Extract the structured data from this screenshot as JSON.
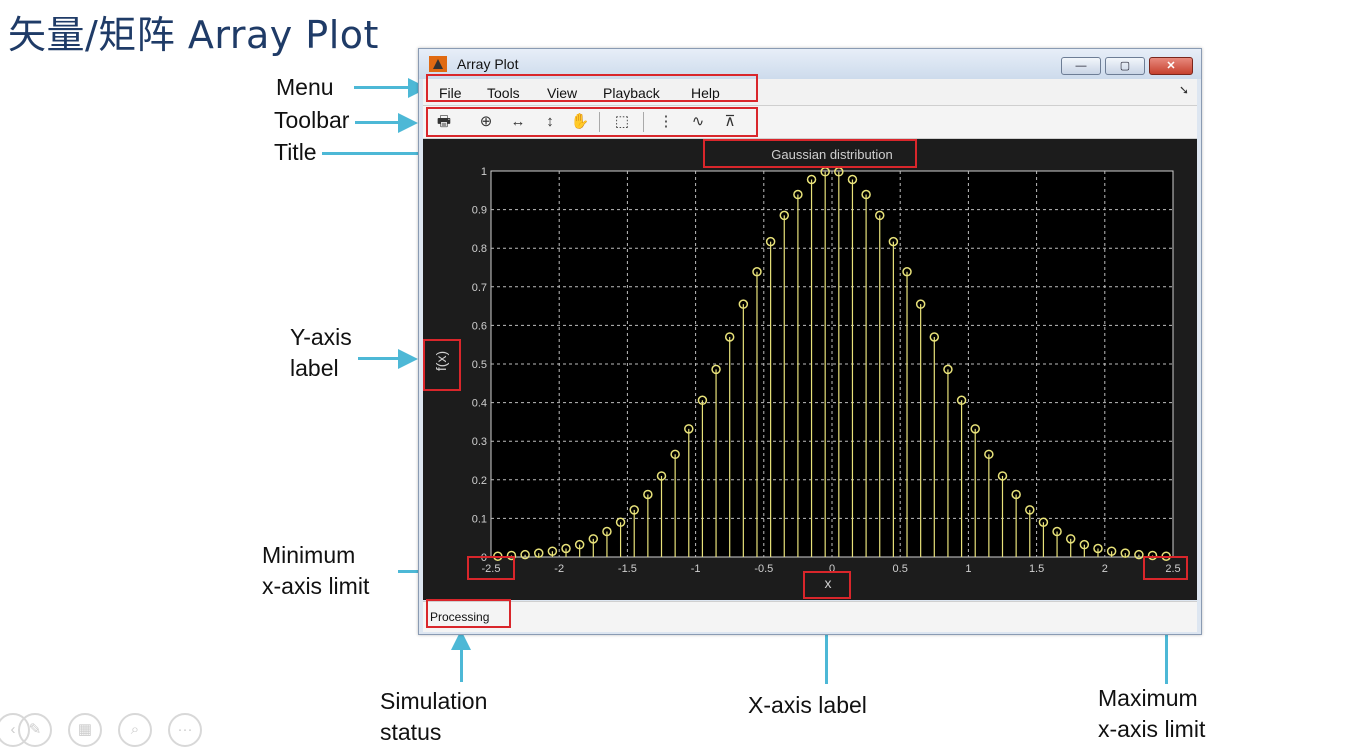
{
  "slide": {
    "title": "矢量/矩阵 Array Plot"
  },
  "callouts": {
    "menu": "Menu",
    "toolbar": "Toolbar",
    "title": "Title",
    "y_axis_label": [
      "Y-axis",
      "label"
    ],
    "min_x_limit": [
      "Minimum",
      "x-axis limit"
    ],
    "simulation_status": [
      "Simulation",
      "status"
    ],
    "x_axis_label": "X-axis label",
    "max_x_limit": [
      "Maximum",
      "x-axis limit"
    ]
  },
  "window": {
    "title": "Array Plot",
    "controls": {
      "minimize": "—",
      "maximize": "▢",
      "close": "✕"
    },
    "menu": [
      "File",
      "Tools",
      "View",
      "Playback",
      "Help"
    ],
    "menu_dock_icon": "dock-arrow-icon",
    "toolbar": [
      {
        "name": "print-icon",
        "glyph": "🖶"
      },
      {
        "name": "zoom-in-icon",
        "glyph": "⊕"
      },
      {
        "name": "zoom-x-icon",
        "glyph": "↔"
      },
      {
        "name": "zoom-y-icon",
        "glyph": "↕"
      },
      {
        "name": "pan-hand-icon",
        "glyph": "✋"
      },
      {
        "name": "autoscale-icon",
        "glyph": "⬚"
      },
      {
        "name": "cursor-measurements-icon",
        "glyph": "⋮"
      },
      {
        "name": "signal-statistics-icon",
        "glyph": "∿"
      },
      {
        "name": "peak-finder-icon",
        "glyph": "⊼"
      }
    ],
    "status": "Processing"
  },
  "chart_data": {
    "type": "stem",
    "title": "Gaussian distribution",
    "xlabel": "x",
    "ylabel": "f(x)",
    "xlim": [
      -2.5,
      2.5
    ],
    "ylim": [
      0,
      1
    ],
    "x_ticks": [
      "-2.5",
      "-2",
      "-1.5",
      "-1",
      "-0.5",
      "0",
      "0.5",
      "1",
      "1.5",
      "2",
      "2.5"
    ],
    "y_ticks": [
      "0",
      "0.1",
      "0.2",
      "0.3",
      "0.4",
      "0.5",
      "0.6",
      "0.7",
      "0.8",
      "0.9",
      "1"
    ],
    "grid": true,
    "background": "#000000",
    "line_color": "#e8e27a",
    "marker": "circle",
    "series": [
      {
        "x": [
          -2.45,
          -2.35,
          -2.25,
          -2.15,
          -2.05,
          -1.95,
          -1.85,
          -1.75,
          -1.65,
          -1.55,
          -1.45,
          -1.35,
          -1.25,
          -1.15,
          -1.05,
          -0.95,
          -0.85,
          -0.75,
          -0.65,
          -0.55,
          -0.45,
          -0.35,
          -0.25,
          -0.15,
          -0.05,
          0.05,
          0.15,
          0.25,
          0.35,
          0.45,
          0.55,
          0.65,
          0.75,
          0.85,
          0.95,
          1.05,
          1.15,
          1.25,
          1.35,
          1.45,
          1.55,
          1.65,
          1.75,
          1.85,
          1.95,
          2.05,
          2.15,
          2.25,
          2.35,
          2.45
        ],
        "y": [
          0.002,
          0.004,
          0.006,
          0.01,
          0.015,
          0.022,
          0.032,
          0.047,
          0.066,
          0.09,
          0.122,
          0.162,
          0.21,
          0.266,
          0.332,
          0.406,
          0.486,
          0.57,
          0.655,
          0.739,
          0.817,
          0.885,
          0.939,
          0.978,
          0.998,
          0.998,
          0.978,
          0.939,
          0.885,
          0.817,
          0.739,
          0.655,
          0.57,
          0.486,
          0.406,
          0.332,
          0.266,
          0.21,
          0.162,
          0.122,
          0.09,
          0.066,
          0.047,
          0.032,
          0.022,
          0.015,
          0.01,
          0.006,
          0.004,
          0.002
        ]
      }
    ]
  }
}
